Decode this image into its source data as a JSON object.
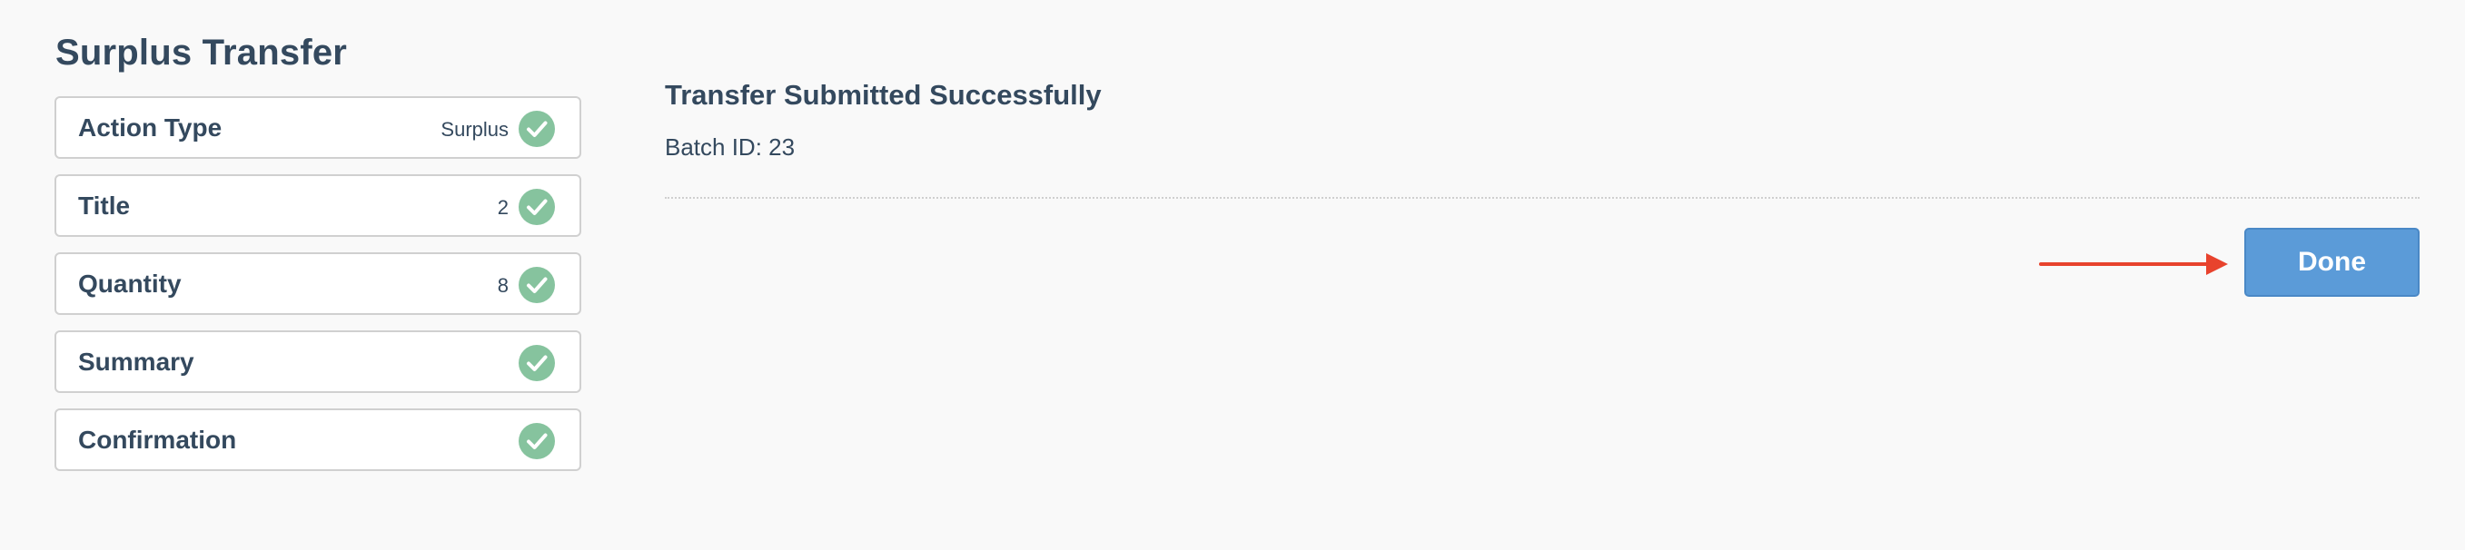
{
  "page": {
    "title": "Surplus Transfer"
  },
  "steps": [
    {
      "label": "Action Type",
      "value": "Surplus",
      "status": "complete"
    },
    {
      "label": "Title",
      "value": "2",
      "status": "complete"
    },
    {
      "label": "Quantity",
      "value": "8",
      "status": "complete"
    },
    {
      "label": "Summary",
      "value": "",
      "status": "complete"
    },
    {
      "label": "Confirmation",
      "value": "",
      "status": "complete"
    }
  ],
  "result": {
    "title": "Transfer Submitted Successfully",
    "batch_text": "Batch ID: 23"
  },
  "actions": {
    "done_label": "Done"
  },
  "colors": {
    "check": "#86c39e",
    "done_button": "#5b9bd8",
    "annotation_arrow": "#e8432d",
    "text": "#34495e"
  },
  "icons": {
    "step_status": "checkmark-circle-icon",
    "annotation": "red-arrow-icon"
  }
}
